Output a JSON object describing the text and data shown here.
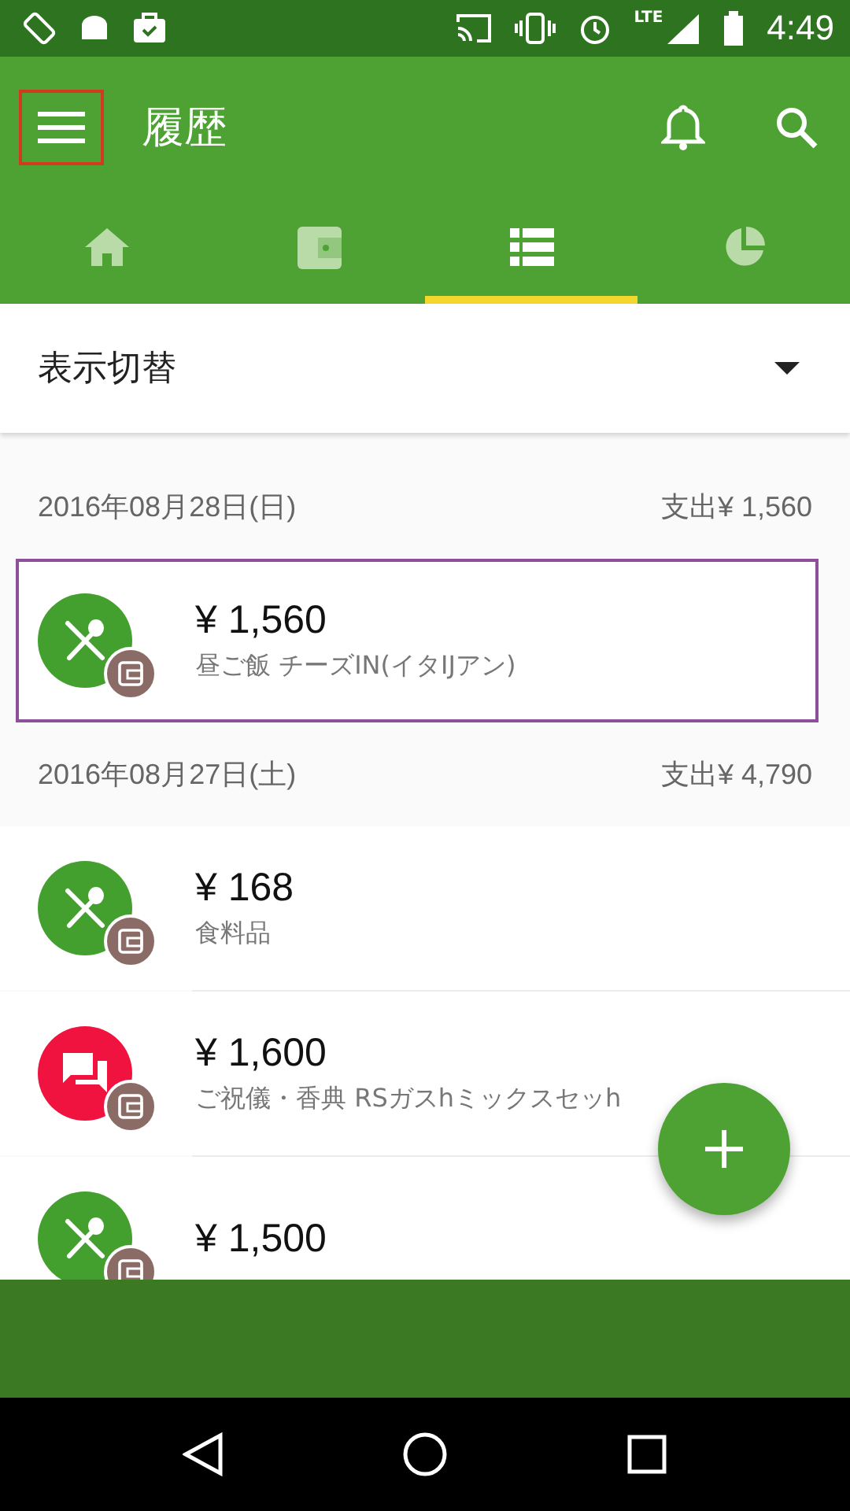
{
  "status_bar": {
    "time": "4:49",
    "network": "LTE"
  },
  "app_bar": {
    "menu_highlighted": true,
    "title": "履歴"
  },
  "tabs": [
    {
      "kind": "home",
      "selected": false
    },
    {
      "kind": "wallet",
      "selected": false
    },
    {
      "kind": "list",
      "selected": true
    },
    {
      "kind": "chart",
      "selected": false
    }
  ],
  "view_switch": {
    "label": "表示切替"
  },
  "groups": [
    {
      "date": "2016年08月28日(日)",
      "total": "支出¥ 1,560",
      "entries": [
        {
          "kind": "food",
          "color": "#43a02e",
          "amount": "¥ 1,560",
          "memo": "昼ご飯 チーズIN(イタIJアン)",
          "highlighted": true
        }
      ]
    },
    {
      "date": "2016年08月27日(土)",
      "total": "支出¥ 4,790",
      "entries": [
        {
          "kind": "food",
          "color": "#43a02e",
          "amount": "¥ 168",
          "memo": "食料品",
          "highlighted": false
        },
        {
          "kind": "gift",
          "color": "#f0133f",
          "amount": "¥ 1,600",
          "memo": "ご祝儀・香典 RSガスhミックスセッh",
          "highlighted": false
        },
        {
          "kind": "food",
          "color": "#43a02e",
          "amount": "¥ 1,500",
          "highlighted": false
        }
      ]
    }
  ]
}
